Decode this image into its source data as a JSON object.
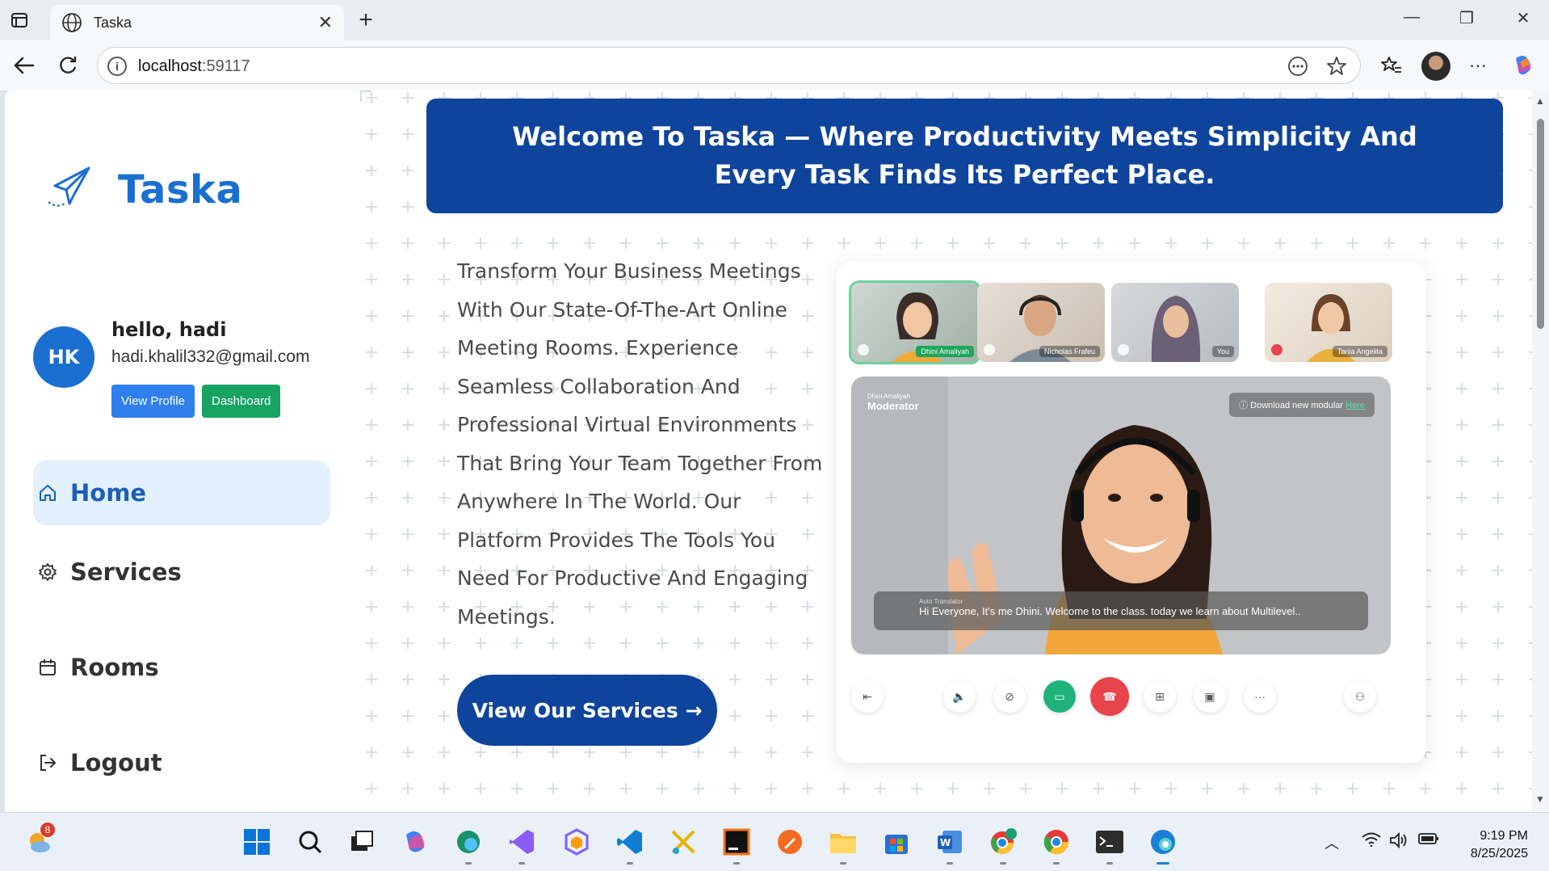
{
  "browser": {
    "tab_title": "Taska",
    "url_host": "localhost",
    "url_port": ":59117"
  },
  "sidebar": {
    "brand": "Taska",
    "user": {
      "initials": "HK",
      "greeting": "hello, hadi",
      "email": "hadi.khalil332@gmail.com",
      "view_profile_label": "View Profile",
      "dashboard_label": "Dashboard"
    },
    "menu": [
      {
        "label": "Home",
        "icon": "home-icon",
        "active": true
      },
      {
        "label": "Services",
        "icon": "gear-icon",
        "active": false
      },
      {
        "label": "Rooms",
        "icon": "calendar-icon",
        "active": false
      },
      {
        "label": "Logout",
        "icon": "logout-icon",
        "active": false
      }
    ]
  },
  "main": {
    "banner_title": "Welcome To Taska — Where Productivity Meets Simplicity And Every Task Finds Its Perfect Place.",
    "description": "Transform Your Business Meetings With Our State-Of-The-Art Online Meeting Rooms. Experience Seamless Collaboration And Professional Virtual Environments That Bring Your Team Together From Anywhere In The World. Our Platform Provides The Tools You Need For Productive And Engaging Meetings.",
    "cta_label": "View Our Services →"
  },
  "meeting": {
    "participants": [
      "Dhini Amaliyah",
      "Nicholas Frafeu",
      "You",
      "Tania Angelita"
    ],
    "speaker_name": "Dhini Amaliyah",
    "speaker_role": "Moderator",
    "download_text": "Download new modular",
    "download_link": "Here",
    "translator_label": "Auto Translator",
    "caption": "Hi Everyone, It's me Dhini. Welcome to the class. today we learn about Multilevel.."
  },
  "taskbar": {
    "weather_badge": "8",
    "time": "9:19 PM",
    "date": "8/25/2025"
  },
  "colors": {
    "brand_blue": "#1b6fd1",
    "banner_navy": "#0f449c",
    "active_bg": "#e3f0fd",
    "profile_btn": "#2f80ed",
    "dashboard_btn": "#17a362"
  }
}
